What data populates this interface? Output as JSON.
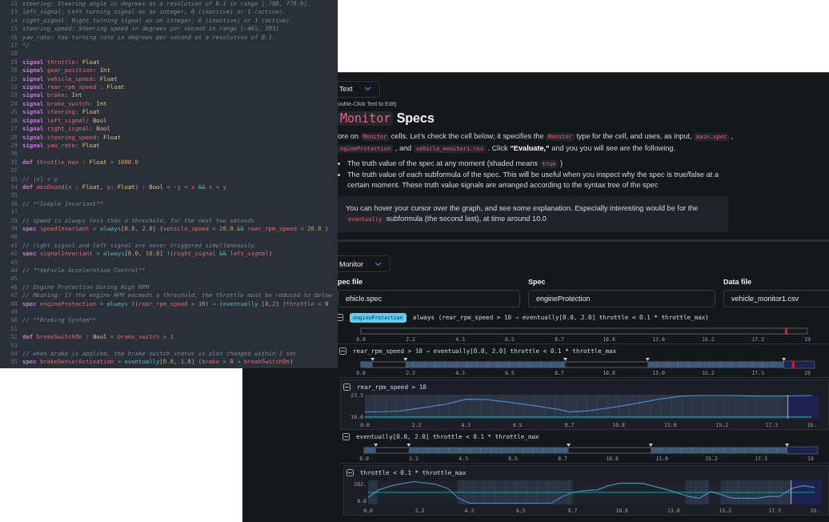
{
  "code_editor": {
    "lines": [
      {
        "number": "12",
        "tokens": [
          {
            "text": "steering: Steering angle in degrees at a resolution of 0.1 in range [-780, 779.9].",
            "kind": "comment"
          }
        ]
      },
      {
        "number": "13",
        "tokens": [
          {
            "text": "left_signal: Left turning signal as an integer, 0 (inactive) or 1 (active).",
            "kind": "comment"
          }
        ]
      },
      {
        "number": "14",
        "tokens": [
          {
            "text": "right_signal: Right turning signal as an integer, 0 (inactive) or 1 (active).",
            "kind": "comment"
          }
        ]
      },
      {
        "number": "15",
        "tokens": [
          {
            "text": "steering_speed: Steering speed in degrees per second in range [-465, 393].",
            "kind": "comment"
          }
        ]
      },
      {
        "number": "16",
        "tokens": [
          {
            "text": "yaw_rate: Yaw turning rate in degrees per second at a resolution of 0.1.",
            "kind": "comment"
          }
        ]
      },
      {
        "number": "17",
        "tokens": [
          {
            "text": "*/",
            "kind": "comment"
          }
        ]
      },
      {
        "number": "18"
      },
      {
        "number": "19",
        "tokens": [
          {
            "text": "signal ",
            "kind": "keyword"
          },
          {
            "text": "throttle",
            "kind": "name"
          },
          {
            "text": ": ",
            "kind": "plain"
          },
          {
            "text": "Float",
            "kind": "type"
          }
        ]
      },
      {
        "number": "20",
        "tokens": [
          {
            "text": "signal ",
            "kind": "keyword"
          },
          {
            "text": "gear_position",
            "kind": "name"
          },
          {
            "text": ": ",
            "kind": "plain"
          },
          {
            "text": "Int",
            "kind": "type"
          }
        ]
      },
      {
        "number": "21",
        "tokens": [
          {
            "text": "signal ",
            "kind": "keyword"
          },
          {
            "text": "vehicle_speed",
            "kind": "name"
          },
          {
            "text": ": ",
            "kind": "plain"
          },
          {
            "text": "Float",
            "kind": "type"
          }
        ]
      },
      {
        "number": "22",
        "tokens": [
          {
            "text": "signal ",
            "kind": "keyword"
          },
          {
            "text": "rear_rpm_speed",
            "kind": "name"
          },
          {
            "text": " : ",
            "kind": "plain"
          },
          {
            "text": "Float",
            "kind": "type"
          }
        ]
      },
      {
        "number": "23",
        "tokens": [
          {
            "text": "signal ",
            "kind": "keyword"
          },
          {
            "text": "brake",
            "kind": "name"
          },
          {
            "text": ": ",
            "kind": "plain"
          },
          {
            "text": "Int",
            "kind": "type"
          }
        ]
      },
      {
        "number": "24",
        "tokens": [
          {
            "text": "signal ",
            "kind": "keyword"
          },
          {
            "text": "brake_switch",
            "kind": "name"
          },
          {
            "text": ": ",
            "kind": "plain"
          },
          {
            "text": "Int",
            "kind": "type"
          }
        ]
      },
      {
        "number": "25",
        "tokens": [
          {
            "text": "signal ",
            "kind": "keyword"
          },
          {
            "text": "steering",
            "kind": "name"
          },
          {
            "text": ": ",
            "kind": "plain"
          },
          {
            "text": "Float",
            "kind": "type"
          }
        ]
      },
      {
        "number": "26",
        "tokens": [
          {
            "text": "signal ",
            "kind": "keyword"
          },
          {
            "text": "left_signal",
            "kind": "name"
          },
          {
            "text": ": ",
            "kind": "plain"
          },
          {
            "text": "Bool",
            "kind": "type"
          }
        ]
      },
      {
        "number": "27",
        "tokens": [
          {
            "text": "signal ",
            "kind": "keyword"
          },
          {
            "text": "right_signal",
            "kind": "name"
          },
          {
            "text": ": ",
            "kind": "plain"
          },
          {
            "text": "Bool",
            "kind": "type"
          }
        ]
      },
      {
        "number": "28",
        "tokens": [
          {
            "text": "signal ",
            "kind": "keyword"
          },
          {
            "text": "steering_speed",
            "kind": "name"
          },
          {
            "text": ": ",
            "kind": "plain"
          },
          {
            "text": "Float",
            "kind": "type"
          }
        ]
      },
      {
        "number": "29",
        "tokens": [
          {
            "text": "signal ",
            "kind": "keyword"
          },
          {
            "text": "yaw_rate",
            "kind": "name"
          },
          {
            "text": ": ",
            "kind": "plain"
          },
          {
            "text": "Float",
            "kind": "type"
          }
        ]
      },
      {
        "number": "30"
      },
      {
        "number": "31",
        "tokens": [
          {
            "text": "def ",
            "kind": "keyword"
          },
          {
            "text": "throttle_max",
            "kind": "name"
          },
          {
            "text": " : ",
            "kind": "plain"
          },
          {
            "text": "Float",
            "kind": "type"
          },
          {
            "text": " = ",
            "kind": "operator"
          },
          {
            "text": "1000.0",
            "kind": "number"
          }
        ]
      },
      {
        "number": "32"
      },
      {
        "number": "33",
        "tokens": [
          {
            "text": "// |x| < y",
            "kind": "comment"
          }
        ]
      },
      {
        "number": "34",
        "tokens": [
          {
            "text": "def ",
            "kind": "keyword"
          },
          {
            "text": "absBound",
            "kind": "name"
          },
          {
            "text": "(",
            "kind": "plain"
          },
          {
            "text": "x",
            "kind": "name"
          },
          {
            "text": " : ",
            "kind": "plain"
          },
          {
            "text": "Float",
            "kind": "type"
          },
          {
            "text": ", ",
            "kind": "plain"
          },
          {
            "text": "y",
            "kind": "name"
          },
          {
            "text": ": ",
            "kind": "plain"
          },
          {
            "text": "Float",
            "kind": "type"
          },
          {
            "text": ") : ",
            "kind": "plain"
          },
          {
            "text": "Bool",
            "kind": "type"
          },
          {
            "text": " = -",
            "kind": "operator"
          },
          {
            "text": "y",
            "kind": "name"
          },
          {
            "text": " < ",
            "kind": "operator"
          },
          {
            "text": "x",
            "kind": "name"
          },
          {
            "text": " && ",
            "kind": "operator"
          },
          {
            "text": "x",
            "kind": "name"
          },
          {
            "text": " < ",
            "kind": "operator"
          },
          {
            "text": "y",
            "kind": "name"
          }
        ]
      },
      {
        "number": "35"
      },
      {
        "number": "36",
        "tokens": [
          {
            "text": "// **Simple Invariant**",
            "kind": "comment"
          }
        ]
      },
      {
        "number": "37"
      },
      {
        "number": "38",
        "tokens": [
          {
            "text": "// speed is always less than a threshold, for the next two seconds",
            "kind": "comment"
          }
        ]
      },
      {
        "number": "39",
        "tokens": [
          {
            "text": "spec ",
            "kind": "keyword"
          },
          {
            "text": "speedInvariant",
            "kind": "name"
          },
          {
            "text": " = ",
            "kind": "operator"
          },
          {
            "text": "always",
            "kind": "function"
          },
          {
            "text": "[",
            "kind": "plain"
          },
          {
            "text": "0.0",
            "kind": "number"
          },
          {
            "text": ", ",
            "kind": "plain"
          },
          {
            "text": "2.0",
            "kind": "number"
          },
          {
            "text": "] (",
            "kind": "plain"
          },
          {
            "text": "vehicle_speed",
            "kind": "name"
          },
          {
            "text": " < ",
            "kind": "operator"
          },
          {
            "text": "20.0",
            "kind": "number"
          },
          {
            "text": " && ",
            "kind": "operator"
          },
          {
            "text": "rear_rpm_speed",
            "kind": "name"
          },
          {
            "text": " < ",
            "kind": "operator"
          },
          {
            "text": "20.0",
            "kind": "number"
          },
          {
            "text": " )",
            "kind": "plain"
          }
        ]
      },
      {
        "number": "40"
      },
      {
        "number": "41",
        "tokens": [
          {
            "text": "// right signal and left signal are never triggered simultaneously.",
            "kind": "comment"
          }
        ]
      },
      {
        "number": "42",
        "tokens": [
          {
            "text": "spec ",
            "kind": "keyword"
          },
          {
            "text": "signalInvariant",
            "kind": "name"
          },
          {
            "text": " = ",
            "kind": "operator"
          },
          {
            "text": "always",
            "kind": "function"
          },
          {
            "text": "[",
            "kind": "plain"
          },
          {
            "text": "0.0",
            "kind": "number"
          },
          {
            "text": ", ",
            "kind": "plain"
          },
          {
            "text": "10.0",
            "kind": "number"
          },
          {
            "text": "] ",
            "kind": "plain"
          },
          {
            "text": "!",
            "kind": "operator"
          },
          {
            "text": "(",
            "kind": "plain"
          },
          {
            "text": "right_signal",
            "kind": "name"
          },
          {
            "text": " && ",
            "kind": "operator"
          },
          {
            "text": "left_signal",
            "kind": "name"
          },
          {
            "text": ")",
            "kind": "plain"
          }
        ]
      },
      {
        "number": "43"
      },
      {
        "number": "44",
        "tokens": [
          {
            "text": "// **Vehicle Acceleration Control**",
            "kind": "comment"
          }
        ]
      },
      {
        "number": "45"
      },
      {
        "number": "46",
        "tokens": [
          {
            "text": "// Engine Protection During High RPM",
            "kind": "comment"
          }
        ]
      },
      {
        "number": "47",
        "tokens": [
          {
            "text": "// Meaning: If the engine RPM exceeds a threshold, the throttle must be reduced to below",
            "kind": "comment"
          }
        ]
      },
      {
        "number": "48",
        "tokens": [
          {
            "text": "spec ",
            "kind": "keyword"
          },
          {
            "text": "engineProtection",
            "kind": "name"
          },
          {
            "text": " = ",
            "kind": "operator"
          },
          {
            "text": "always",
            "kind": "function"
          },
          {
            "text": " ((",
            "kind": "plain"
          },
          {
            "text": "rear_rpm_speed",
            "kind": "name"
          },
          {
            "text": " > ",
            "kind": "operator"
          },
          {
            "text": "10",
            "kind": "number"
          },
          {
            "text": ") ",
            "kind": "plain"
          },
          {
            "text": "⇒",
            "kind": "operator"
          },
          {
            "text": " (",
            "kind": "plain"
          },
          {
            "text": "eventually",
            "kind": "function"
          },
          {
            "text": " [",
            "kind": "plain"
          },
          {
            "text": "0",
            "kind": "number"
          },
          {
            "text": ",",
            "kind": "plain"
          },
          {
            "text": "2",
            "kind": "number"
          },
          {
            "text": "] (",
            "kind": "plain"
          },
          {
            "text": "throttle",
            "kind": "name"
          },
          {
            "text": " < ",
            "kind": "operator"
          },
          {
            "text": "0",
            "kind": "number"
          }
        ]
      },
      {
        "number": "49"
      },
      {
        "number": "50",
        "tokens": [
          {
            "text": "// **Braking System**",
            "kind": "comment"
          }
        ]
      },
      {
        "number": "51"
      },
      {
        "number": "52",
        "tokens": [
          {
            "text": "def ",
            "kind": "keyword"
          },
          {
            "text": "breakSwitchOn",
            "kind": "name"
          },
          {
            "text": " : ",
            "kind": "plain"
          },
          {
            "text": "Bool",
            "kind": "type"
          },
          {
            "text": " = ",
            "kind": "operator"
          },
          {
            "text": "brake_switch",
            "kind": "name"
          },
          {
            "text": " > ",
            "kind": "operator"
          },
          {
            "text": "1",
            "kind": "number"
          }
        ]
      },
      {
        "number": "53"
      },
      {
        "number": "54",
        "tokens": [
          {
            "text": "// when brake is applied, the brake switch status is also changed within 1 sec.",
            "kind": "comment"
          }
        ]
      },
      {
        "number": "55",
        "tokens": [
          {
            "text": "spec ",
            "kind": "keyword"
          },
          {
            "text": "brakeSensorActivation",
            "kind": "name"
          },
          {
            "text": " = ",
            "kind": "operator"
          },
          {
            "text": "eventually",
            "kind": "function"
          },
          {
            "text": "[",
            "kind": "plain"
          },
          {
            "text": "0.0",
            "kind": "number"
          },
          {
            "text": ", ",
            "kind": "plain"
          },
          {
            "text": "1.0",
            "kind": "number"
          },
          {
            "text": "] (",
            "kind": "plain"
          },
          {
            "text": "brake",
            "kind": "name"
          },
          {
            "text": " > ",
            "kind": "operator"
          },
          {
            "text": "0",
            "kind": "number"
          },
          {
            "text": " ⇒ ",
            "kind": "operator"
          },
          {
            "text": "breakSwitchOn",
            "kind": "name"
          },
          {
            "text": ")",
            "kind": "plain"
          }
        ]
      }
    ]
  },
  "notebook": {
    "text_cell": {
      "cell_type": "Text",
      "hint": "ouble-Click Text to Edit)",
      "heading": {
        "code": "Monitor",
        "text": "Specs"
      },
      "paragraph": [
        {
          "text": "ore on ",
          "kind": "text"
        },
        {
          "text": "Monitor",
          "kind": "code"
        },
        {
          "text": " cells. Let’s check the cell below; it specifies the ",
          "kind": "text"
        },
        {
          "text": "Monitor",
          "kind": "code"
        },
        {
          "text": " type for the cell, and uses, as input, ",
          "kind": "text"
        },
        {
          "text": "main.spec",
          "kind": "code"
        },
        {
          "text": " , ",
          "kind": "text"
        },
        {
          "text": "ngineProtection",
          "kind": "code"
        },
        {
          "text": " , and ",
          "kind": "text"
        },
        {
          "text": "vehicle_monitor1.csv",
          "kind": "code"
        },
        {
          "text": " . Click ",
          "kind": "text"
        },
        {
          "text": "“Evaluate,”",
          "kind": "bold"
        },
        {
          "text": " and you you will see are the following.",
          "kind": "text"
        }
      ],
      "bullets": [
        [
          {
            "text": "The truth value of the spec at any moment (shaded means ",
            "kind": "text"
          },
          {
            "text": "true",
            "kind": "code"
          },
          {
            "text": " )",
            "kind": "text"
          }
        ],
        [
          {
            "text": "The truth value of each subformula of the spec. This will be useful when you inspect why the spec is true/false at a certain moment. These truth value signals are arranged according to the syntax tree of the spec",
            "kind": "text"
          }
        ]
      ],
      "callout": [
        {
          "text": "You can hover your cursor over the graph, and see some explanation. Especially interesting would be for the ",
          "kind": "text"
        },
        {
          "text": "eventually",
          "kind": "code"
        },
        {
          "text": " subformula (the second last), at time around 10.0",
          "kind": "text"
        }
      ]
    },
    "monitor_cell": {
      "cell_type": "Monitor",
      "fields": [
        {
          "label": "pec file",
          "value": "ehicle.spec"
        },
        {
          "label": "Spec",
          "value": "engineProtection"
        },
        {
          "label": "Data file",
          "value": "vehicle_monitor1.csv"
        }
      ],
      "tree": [
        {
          "kind": "truth",
          "badge": "engineProtection",
          "formula": "always (rear_rpm_speed > 10 ⇒ eventually[0.0, 2.0] throttle < 0.1 * throttle_max)",
          "tick_labels": [
            "0.0",
            "2.2",
            "4.3",
            "6.5",
            "8.7",
            "10.8",
            "13.0",
            "15.2",
            "17.3",
            "19"
          ],
          "children": [
            {
              "kind": "truth",
              "formula": "rear_rpm_speed > 10 ⇒ eventually[0.0, 2.0] throttle < 0.1 * throttle_max",
              "tick_labels": [
                "0.0",
                "2.2",
                "4.3",
                "6.5",
                "8.7",
                "10.8",
                "13.0",
                "15.2",
                "17.3",
                "19"
              ],
              "children": [
                {
                  "kind": "line",
                  "formula": "rear_rpm_speed > 10",
                  "chart_data": {
                    "type": "line",
                    "x": [
                      0,
                      0.5,
                      1.5,
                      2.5,
                      3.5,
                      4.3,
                      5.2,
                      6.2,
                      7.2,
                      8.3,
                      8.7,
                      9.5,
                      10.5,
                      11.5,
                      12.5,
                      13.5,
                      14.5,
                      15.5,
                      16.5,
                      17.5,
                      19
                    ],
                    "series": [
                      {
                        "color": "#4a8ac0",
                        "values": [
                          13.2,
                          13.1,
                          13.7,
                          15.8,
                          18.0,
                          21.0,
                          20.7,
                          19.0,
                          17.0,
                          14.5,
                          13.0,
                          13.8,
                          15.8,
                          18.3,
                          21.0,
                          23.0,
                          23.3,
                          23.3,
                          23.0,
                          22.8,
                          23.3
                        ]
                      }
                    ],
                    "xlim": [
                      0,
                      19
                    ],
                    "ylim": [
                      9.4,
                      23.3
                    ],
                    "yticks": [
                      {
                        "value": 10,
                        "label": "10.0"
                      },
                      {
                        "value": 23.3,
                        "label": "23.3"
                      }
                    ],
                    "xticks": [
                      {
                        "value": 0,
                        "label": "0.0"
                      },
                      {
                        "value": 2.2,
                        "label": "2.2"
                      },
                      {
                        "value": 4.3,
                        "label": "4.3"
                      },
                      {
                        "value": 6.5,
                        "label": "6.5"
                      },
                      {
                        "value": 8.7,
                        "label": "8.7"
                      },
                      {
                        "value": 10.8,
                        "label": "10.8"
                      },
                      {
                        "value": 13,
                        "label": "13.0"
                      },
                      {
                        "value": 15.2,
                        "label": "15.2"
                      },
                      {
                        "value": 17.3,
                        "label": "17.3"
                      },
                      {
                        "value": 19,
                        "label": "19."
                      }
                    ],
                    "grid": true,
                    "ref_lines": [
                      {
                        "axis": "y",
                        "value": 10,
                        "color": "#14a3a0"
                      },
                      {
                        "axis": "x",
                        "value": 18,
                        "color": "#d8dbe2"
                      }
                    ],
                    "bands": [
                      {
                        "axis": "x",
                        "from": 0,
                        "to": 18,
                        "color": "#2a3444"
                      },
                      {
                        "axis": "x",
                        "from": 18,
                        "to": 19,
                        "color": "#1e2250"
                      }
                    ]
                  }
                },
                {
                  "kind": "truth",
                  "formula": "eventually[0.0, 2.0] throttle < 0.1 * throttle_max",
                  "tick_labels": [
                    "0.0",
                    "2.2",
                    "4.3",
                    "6.5",
                    "8.7",
                    "10.8",
                    "13.0",
                    "15.2",
                    "17.3",
                    "19"
                  ],
                  "children": [
                    {
                      "kind": "line",
                      "formula": "throttle < 0.1 * throttle_max",
                      "chart_data": {
                        "type": "line",
                        "x": [
                          0,
                          0.45,
                          1.0,
                          1.94,
                          2.83,
                          3.37,
                          3.85,
                          4.32,
                          7.79,
                          8.26,
                          8.74,
                          9.21,
                          9.76,
                          10.23,
                          10.71,
                          11.66,
                          12.2,
                          12.88,
                          13.63,
                          14.1,
                          14.58,
                          15.06,
                          15.53,
                          16.08,
                          16.55,
                          17.03,
                          17.5,
                          18.05,
                          18.52,
                          19
                        ],
                        "series": [
                          {
                            "color": "#4a8ac0",
                            "values": [
                              40,
                              130,
                              180,
                              230,
                              200,
                              150,
                              30,
                              -30,
                              -30,
                              50,
                              100,
                              120,
                              130,
                              180,
                              210,
                              210,
                              170,
                              120,
                              50,
                              30,
                              110,
                              70,
                              30,
                              30,
                              30,
                              50,
                              50,
                              150,
                              180,
                              160
                            ]
                          }
                        ],
                        "xlim": [
                          0,
                          19
                        ],
                        "ylim": [
                          -35,
                          235
                        ],
                        "yticks": [
                          {
                            "value": 0,
                            "label": "0.0"
                          },
                          {
                            "value": 202,
                            "label": "202."
                          }
                        ],
                        "xticks": [
                          {
                            "value": 0,
                            "label": "0.0"
                          },
                          {
                            "value": 2.2,
                            "label": "2.2"
                          },
                          {
                            "value": 4.3,
                            "label": "4.3"
                          },
                          {
                            "value": 6.5,
                            "label": "6.5"
                          },
                          {
                            "value": 8.7,
                            "label": "8.7"
                          },
                          {
                            "value": 10.8,
                            "label": "10.8"
                          },
                          {
                            "value": 13,
                            "label": "13.0"
                          },
                          {
                            "value": 15.2,
                            "label": "15.2"
                          },
                          {
                            "value": 17.3,
                            "label": "17.3"
                          },
                          {
                            "value": 19,
                            "label": "19."
                          }
                        ],
                        "grid": true,
                        "ref_lines": [
                          {
                            "axis": "y",
                            "value": 100,
                            "color": "#14a3a0"
                          },
                          {
                            "axis": "x",
                            "value": 18,
                            "color": "#d8dbe2"
                          }
                        ],
                        "bands": [
                          {
                            "axis": "x",
                            "from": 0,
                            "to": 0.4,
                            "color": "#2a3444"
                          },
                          {
                            "axis": "x",
                            "from": 3.8,
                            "to": 8.7,
                            "color": "#2a3444"
                          },
                          {
                            "axis": "x",
                            "from": 13.5,
                            "to": 14.5,
                            "color": "#2a3444"
                          },
                          {
                            "axis": "x",
                            "from": 15,
                            "to": 18,
                            "color": "#2a3444"
                          },
                          {
                            "axis": "x",
                            "from": 18,
                            "to": 19,
                            "color": "#1e2250"
                          }
                        ]
                      }
                    }
                  ]
                }
              ]
            }
          ]
        }
      ]
    }
  }
}
